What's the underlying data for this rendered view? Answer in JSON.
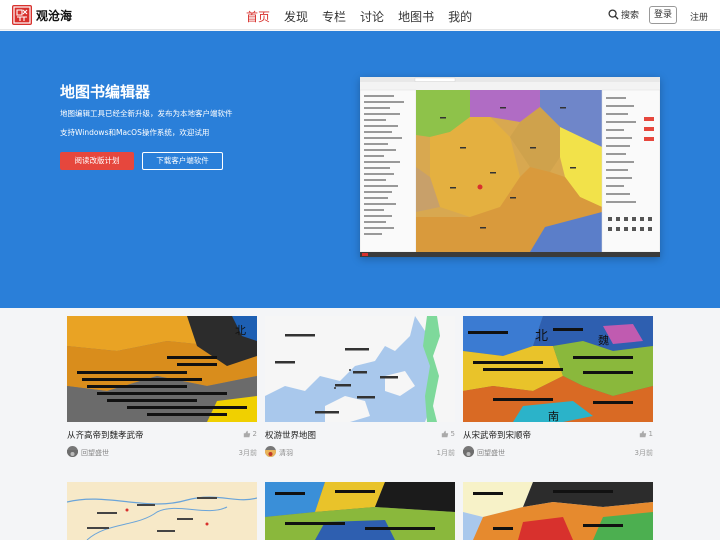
{
  "header": {
    "logo_text": "观沧海",
    "nav": [
      {
        "label": "首页",
        "active": true
      },
      {
        "label": "发现",
        "active": false
      },
      {
        "label": "专栏",
        "active": false
      },
      {
        "label": "讨论",
        "active": false
      },
      {
        "label": "地图书",
        "active": false
      },
      {
        "label": "我的",
        "active": false
      }
    ],
    "search_label": "搜索",
    "login_label": "登录",
    "register_label": "注册"
  },
  "hero": {
    "title": "地图书编辑器",
    "subtitle1": "地图编辑工具已经全新升级，发布为本地客户端软件",
    "subtitle2": "支持Windows和MacOS操作系统，欢迎试用",
    "read_button": "阅读改版计划",
    "download_button": "下载客户端软件"
  },
  "cards": [
    {
      "title": "从齐高帝到魏孝武帝",
      "likes": "2",
      "author": "回望盛世",
      "time": "3月前"
    },
    {
      "title": "权游世界地图",
      "likes": "5",
      "author": "清羽",
      "time": "1月前"
    },
    {
      "title": "从宋武帝到宋顺帝",
      "likes": "1",
      "author": "回望盛世",
      "time": "3月前"
    }
  ],
  "colors": {
    "accent": "#d8312d",
    "hero_bg": "#2a7fd9",
    "read_button_bg": "#e6473d"
  }
}
